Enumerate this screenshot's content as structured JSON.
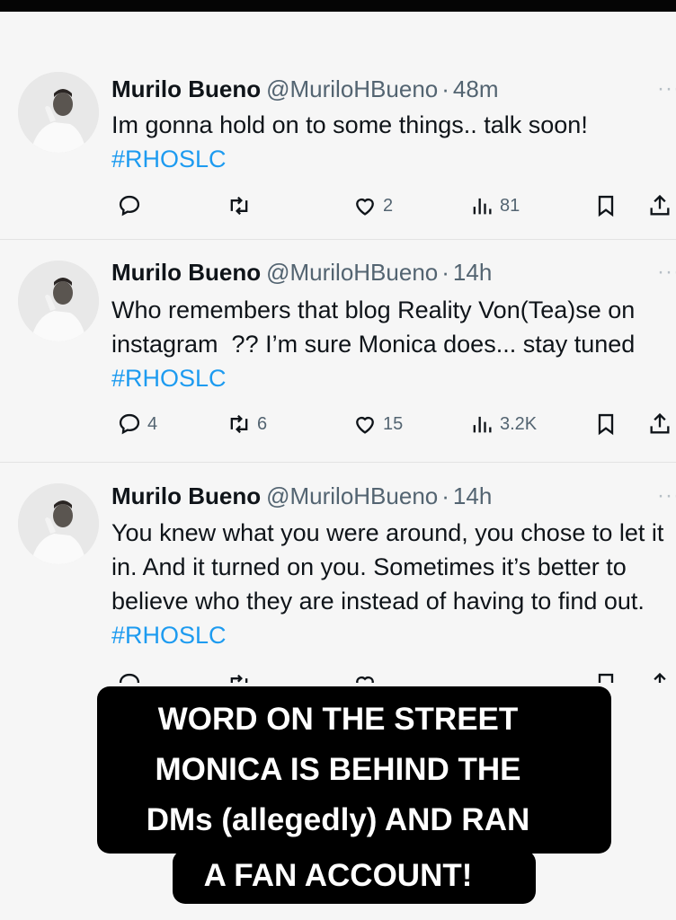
{
  "tweets": [
    {
      "name": "Murilo Bueno",
      "handle": "@MuriloHBueno",
      "time": "48m",
      "text": "Im gonna hold on to some things.. talk soon!",
      "hashtag": "#RHOSLC",
      "replies": "",
      "retweets": "",
      "likes": "2",
      "views": "81"
    },
    {
      "name": "Murilo Bueno",
      "handle": "@MuriloHBueno",
      "time": "14h",
      "text": "Who remembers that blog Reality Von(Tea)se on instagram  ?? I’m sure Monica does... stay tuned ",
      "hashtag": "#RHOSLC",
      "replies": "4",
      "retweets": "6",
      "likes": "15",
      "views": "3.2K"
    },
    {
      "name": "Murilo Bueno",
      "handle": "@MuriloHBueno",
      "time": "14h",
      "text": "You knew what you were around, you chose to let it in. And it turned on you. Sometimes it’s better to believe who they are instead of having to find out. ",
      "hashtag": "#RHOSLC"
    }
  ],
  "more_label": "···",
  "separator": "·",
  "caption": {
    "lines": [
      "WORD ON THE STREET",
      "MONICA IS BEHIND THE",
      "DMs (allegedly) AND RAN",
      "A FAN ACCOUNT!"
    ],
    "background": "#000000",
    "color": "#ffffff"
  },
  "colors": {
    "hashtag": "#1d9bf0",
    "text": "#0f1419",
    "secondary": "#536471"
  }
}
